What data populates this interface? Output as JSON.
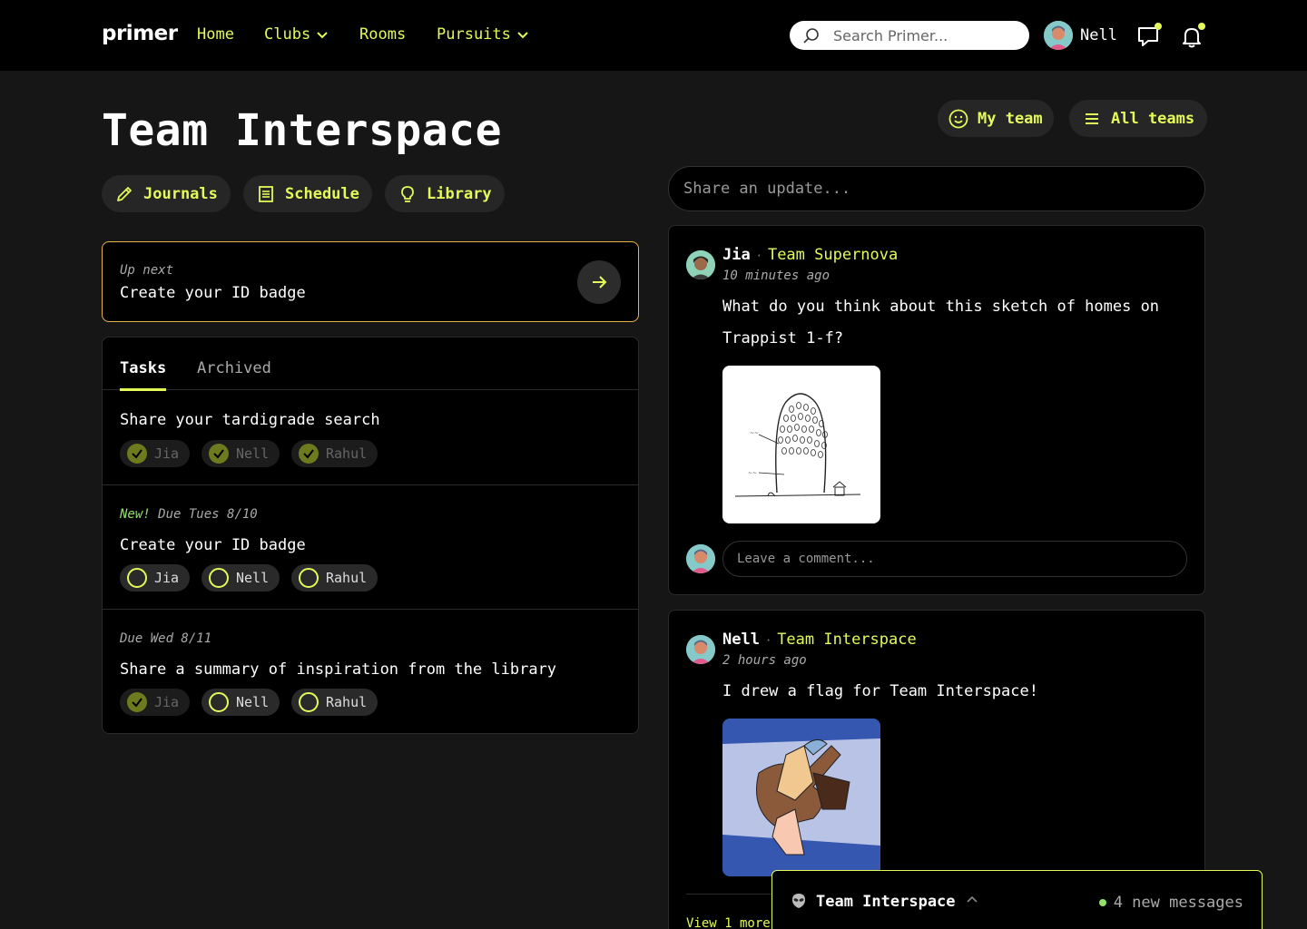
{
  "nav": {
    "logo": "primer",
    "links": [
      {
        "label": "Home"
      },
      {
        "label": "Clubs"
      },
      {
        "label": "Rooms"
      },
      {
        "label": "Pursuits"
      }
    ],
    "search_placeholder": "Search Primer...",
    "user_name": "Nell"
  },
  "header": {
    "title": "Team Interspace",
    "my_team": "My team",
    "all_teams": "All teams",
    "actions": [
      "Journals",
      "Schedule",
      "Library"
    ]
  },
  "up_next": {
    "label": "Up next",
    "value": "Create your ID badge"
  },
  "tasks": {
    "tabs": [
      "Tasks",
      "Archived"
    ],
    "items": [
      {
        "meta_new": "",
        "meta": "",
        "title": "Share your tardigrade search",
        "people": [
          "Jia",
          "Nell",
          "Rahul"
        ]
      },
      {
        "meta_new": "New!",
        "meta": "Due Tues 8/10",
        "title": "Create your ID badge",
        "people": [
          "Jia",
          "Nell",
          "Rahul"
        ]
      },
      {
        "meta_new": "",
        "meta": "Due Wed 8/11",
        "title": "Share a summary of inspiration from the library",
        "people": [
          "Jia",
          "Nell",
          "Rahul"
        ]
      }
    ]
  },
  "feed": {
    "share_placeholder": "Share an update...",
    "posts": [
      {
        "author": "Jia",
        "team": "Team Supernova",
        "time": "10 minutes ago",
        "text": "What do you think about this sketch of homes on Trappist 1-f?",
        "comment_placeholder": "Leave a comment..."
      },
      {
        "author": "Nell",
        "team": "Team Interspace",
        "time": "2 hours ago",
        "text": "I drew a flag for Team Interspace!",
        "view_more": "View 1 more"
      }
    ]
  },
  "chat": {
    "title": "Team Interspace",
    "messages": "4 new messages"
  },
  "colors": {
    "accent": "#e5f95a",
    "background": "#161616",
    "card": "#000000",
    "upnext_border": "#e8b24a",
    "new_green": "#8fe36b"
  }
}
